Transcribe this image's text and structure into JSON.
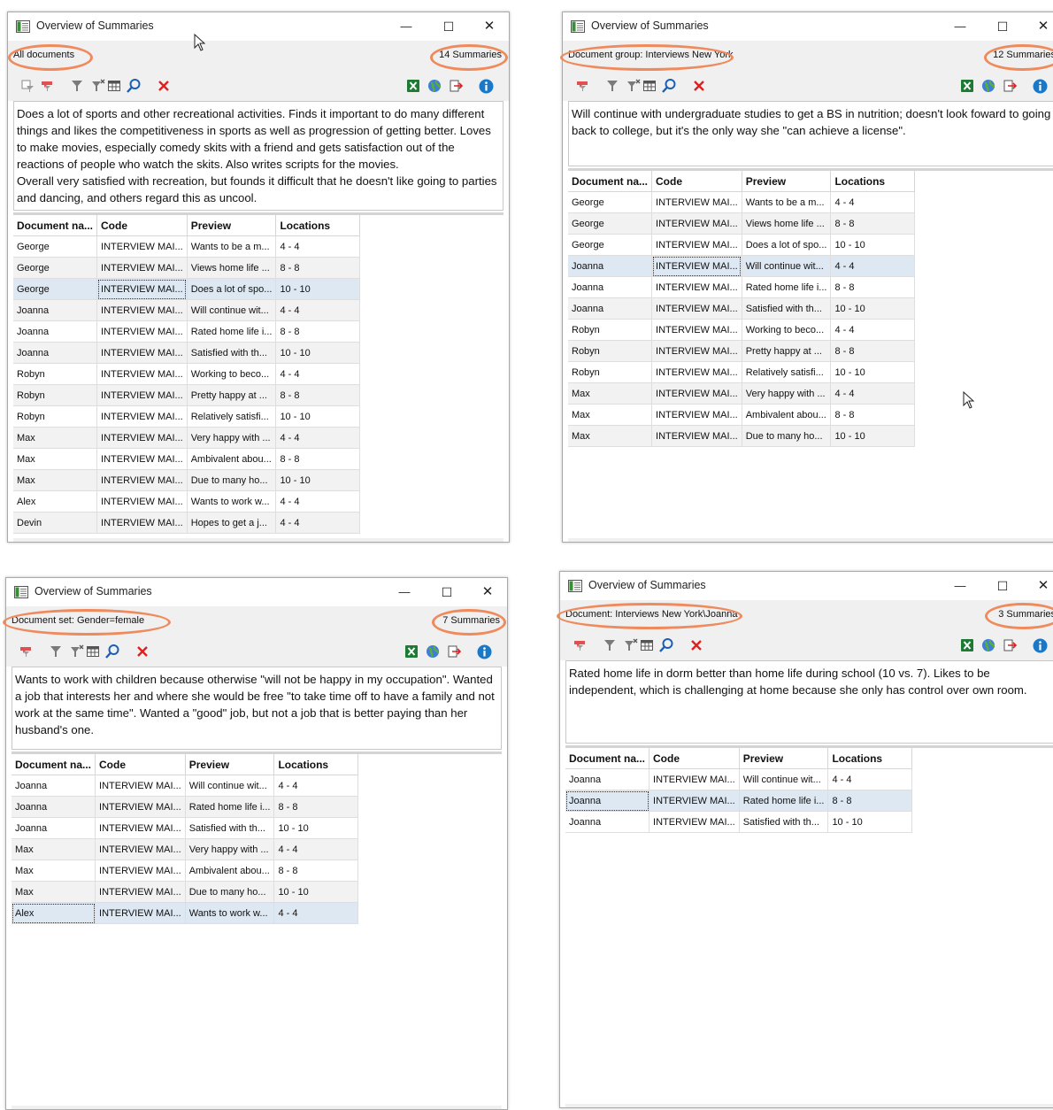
{
  "app_title": "Overview of Summaries",
  "window_controls": {
    "minimize": "—",
    "maximize": "☐",
    "close": "✕"
  },
  "columns": [
    "Document na...",
    "Code",
    "Preview",
    "Locations"
  ],
  "colors": {
    "highlight_ring": "#ef8a5c",
    "delete_icon": "#e02020",
    "excel_icon": "#1e7b34",
    "info_icon": "#1a78c8",
    "filter_icon": "#7a7a7a"
  },
  "icons": [
    "code-filter-icon",
    "code-tag-icon",
    "filter-icon",
    "clear-filter-icon",
    "table-columns-icon",
    "search-icon",
    "delete-icon",
    "excel-export-icon",
    "web-export-icon",
    "export-icon",
    "info-icon"
  ],
  "windows": [
    {
      "scope": "All documents",
      "count": "14 Summaries",
      "summary_text": "Does a lot of sports and other recreational activities. Finds it important to do many different things and likes the competitiveness in sports as well as progression of getting better. Loves to make movies, especially comedy skits with a friend and gets satisfaction out of the reactions of people who watch the skits. Also writes scripts for the movies.\nOverall very satisfied with recreation, but founds it difficult that he doesn't like going to parties and dancing, and others regard this as uncool.",
      "rows": [
        [
          "George",
          "INTERVIEW MAI...",
          "Wants to be a m...",
          "4 - 4"
        ],
        [
          "George",
          "INTERVIEW MAI...",
          "Views home life ...",
          "8 - 8"
        ],
        [
          "George",
          "INTERVIEW MAI...",
          "Does a lot of spo...",
          "10 - 10"
        ],
        [
          "Joanna",
          "INTERVIEW MAI...",
          "Will continue wit...",
          "4 - 4"
        ],
        [
          "Joanna",
          "INTERVIEW MAI...",
          "Rated home life i...",
          "8 - 8"
        ],
        [
          "Joanna",
          "INTERVIEW MAI...",
          "Satisfied with th...",
          "10 - 10"
        ],
        [
          "Robyn",
          "INTERVIEW MAI...",
          "Working to beco...",
          "4 - 4"
        ],
        [
          "Robyn",
          "INTERVIEW MAI...",
          "Pretty happy at ...",
          "8 - 8"
        ],
        [
          "Robyn",
          "INTERVIEW MAI...",
          "Relatively satisfi...",
          "10 - 10"
        ],
        [
          "Max",
          "INTERVIEW MAI...",
          "Very happy with ...",
          "4 - 4"
        ],
        [
          "Max",
          "INTERVIEW MAI...",
          "Ambivalent abou...",
          "8 - 8"
        ],
        [
          "Max",
          "INTERVIEW MAI...",
          "Due to many ho...",
          "10 - 10"
        ],
        [
          "Alex",
          "INTERVIEW MAI...",
          "Wants to work w...",
          "4 - 4"
        ],
        [
          "Devin",
          "INTERVIEW MAI...",
          "Hopes to get a j...",
          "4 - 4"
        ]
      ],
      "selected_row": 2,
      "selected_col": 1
    },
    {
      "scope": "Document group: Interviews New York",
      "count": "12 Summaries",
      "summary_text": "Will continue with undergraduate studies to get a BS in nutrition; doesn't look foward to going back to college, but it's the only way she \"can achieve a license\".",
      "rows": [
        [
          "George",
          "INTERVIEW MAI...",
          "Wants to be a m...",
          "4 - 4"
        ],
        [
          "George",
          "INTERVIEW MAI...",
          "Views home life ...",
          "8 - 8"
        ],
        [
          "George",
          "INTERVIEW MAI...",
          "Does a lot of spo...",
          "10 - 10"
        ],
        [
          "Joanna",
          "INTERVIEW MAI...",
          "Will continue wit...",
          "4 - 4"
        ],
        [
          "Joanna",
          "INTERVIEW MAI...",
          "Rated home life i...",
          "8 - 8"
        ],
        [
          "Joanna",
          "INTERVIEW MAI...",
          "Satisfied with th...",
          "10 - 10"
        ],
        [
          "Robyn",
          "INTERVIEW MAI...",
          "Working to beco...",
          "4 - 4"
        ],
        [
          "Robyn",
          "INTERVIEW MAI...",
          "Pretty happy at ...",
          "8 - 8"
        ],
        [
          "Robyn",
          "INTERVIEW MAI...",
          "Relatively satisfi...",
          "10 - 10"
        ],
        [
          "Max",
          "INTERVIEW MAI...",
          "Very happy with ...",
          "4 - 4"
        ],
        [
          "Max",
          "INTERVIEW MAI...",
          "Ambivalent abou...",
          "8 - 8"
        ],
        [
          "Max",
          "INTERVIEW MAI...",
          "Due to many ho...",
          "10 - 10"
        ]
      ],
      "selected_row": 3,
      "selected_col": 1
    },
    {
      "scope": "Document set: Gender=female",
      "count": "7 Summaries",
      "summary_text": "Wants to work with children because otherwise \"will not be happy in my occupation\". Wanted a job that interests her and where she would be free \"to take time off to have a family and not work at the same time\". Wanted a \"good\" job, but not a job that is better paying than her husband's one.",
      "rows": [
        [
          "Joanna",
          "INTERVIEW MAI...",
          "Will continue wit...",
          "4 - 4"
        ],
        [
          "Joanna",
          "INTERVIEW MAI...",
          "Rated home life i...",
          "8 - 8"
        ],
        [
          "Joanna",
          "INTERVIEW MAI...",
          "Satisfied with th...",
          "10 - 10"
        ],
        [
          "Max",
          "INTERVIEW MAI...",
          "Very happy with ...",
          "4 - 4"
        ],
        [
          "Max",
          "INTERVIEW MAI...",
          "Ambivalent abou...",
          "8 - 8"
        ],
        [
          "Max",
          "INTERVIEW MAI...",
          "Due to many ho...",
          "10 - 10"
        ],
        [
          "Alex",
          "INTERVIEW MAI...",
          "Wants to work w...",
          "4 - 4"
        ]
      ],
      "selected_row": 6,
      "selected_col": 0
    },
    {
      "scope": "Document: Interviews New York\\Joanna",
      "count": "3 Summaries",
      "summary_text": "Rated home life in dorm better than home life during school (10 vs. 7). Likes to be independent, which is challenging at home because she only has control over own room.",
      "rows": [
        [
          "Joanna",
          "INTERVIEW MAI...",
          "Will continue wit...",
          "4 - 4"
        ],
        [
          "Joanna",
          "INTERVIEW MAI...",
          "Rated home life i...",
          "8 - 8"
        ],
        [
          "Joanna",
          "INTERVIEW MAI...",
          "Satisfied with th...",
          "10 - 10"
        ]
      ],
      "selected_row": 1,
      "selected_col": 0
    }
  ]
}
